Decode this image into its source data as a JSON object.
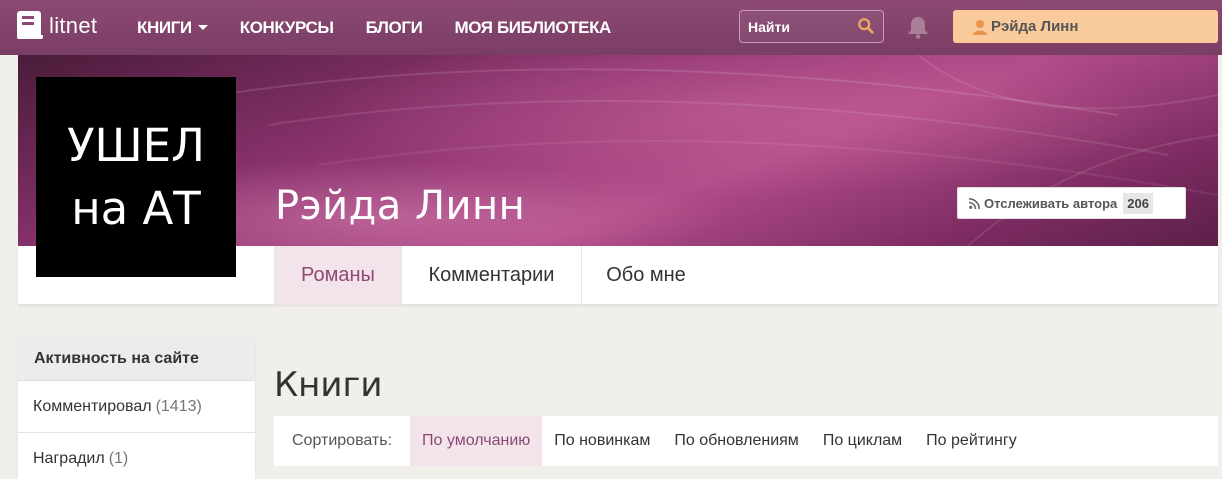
{
  "nav": {
    "logo_text": "litnet",
    "links": [
      "КНИГИ",
      "КОНКУРСЫ",
      "БЛОГИ",
      "МОЯ БИБЛИОТЕКА"
    ],
    "search_placeholder": "Найти",
    "user_name": "Рэйда Линн"
  },
  "profile": {
    "avatar_lines": [
      "УШЕЛ",
      "на АТ"
    ],
    "author_name": "Рэйда Линн",
    "follow_label": "Отслеживать автора",
    "follow_count": "206"
  },
  "tabs": [
    {
      "label": "Романы",
      "active": true
    },
    {
      "label": "Комментарии",
      "active": false
    },
    {
      "label": "Обо мне",
      "active": false
    }
  ],
  "sidebar": {
    "title": "Активность на сайте",
    "items": [
      {
        "label": "Комментировал",
        "count": "(1413)"
      },
      {
        "label": "Наградил",
        "count": "(1)"
      }
    ]
  },
  "books": {
    "title": "Книги",
    "sort_label": "Сортировать:",
    "sort_options": [
      "По умолчанию",
      "По новинкам",
      "По обновлениям",
      "По циклам",
      "По рейтингу"
    ],
    "sort_active": "По умолчанию"
  },
  "colors": {
    "navbar": "#8c4a73",
    "accent_tab": "#f3e4ec",
    "user_button": "#f9cb9c"
  },
  "icons": {
    "logo": "litnet-logo-icon",
    "search": "search-icon",
    "bell": "bell-icon",
    "user": "user-icon",
    "rss": "rss-icon"
  }
}
